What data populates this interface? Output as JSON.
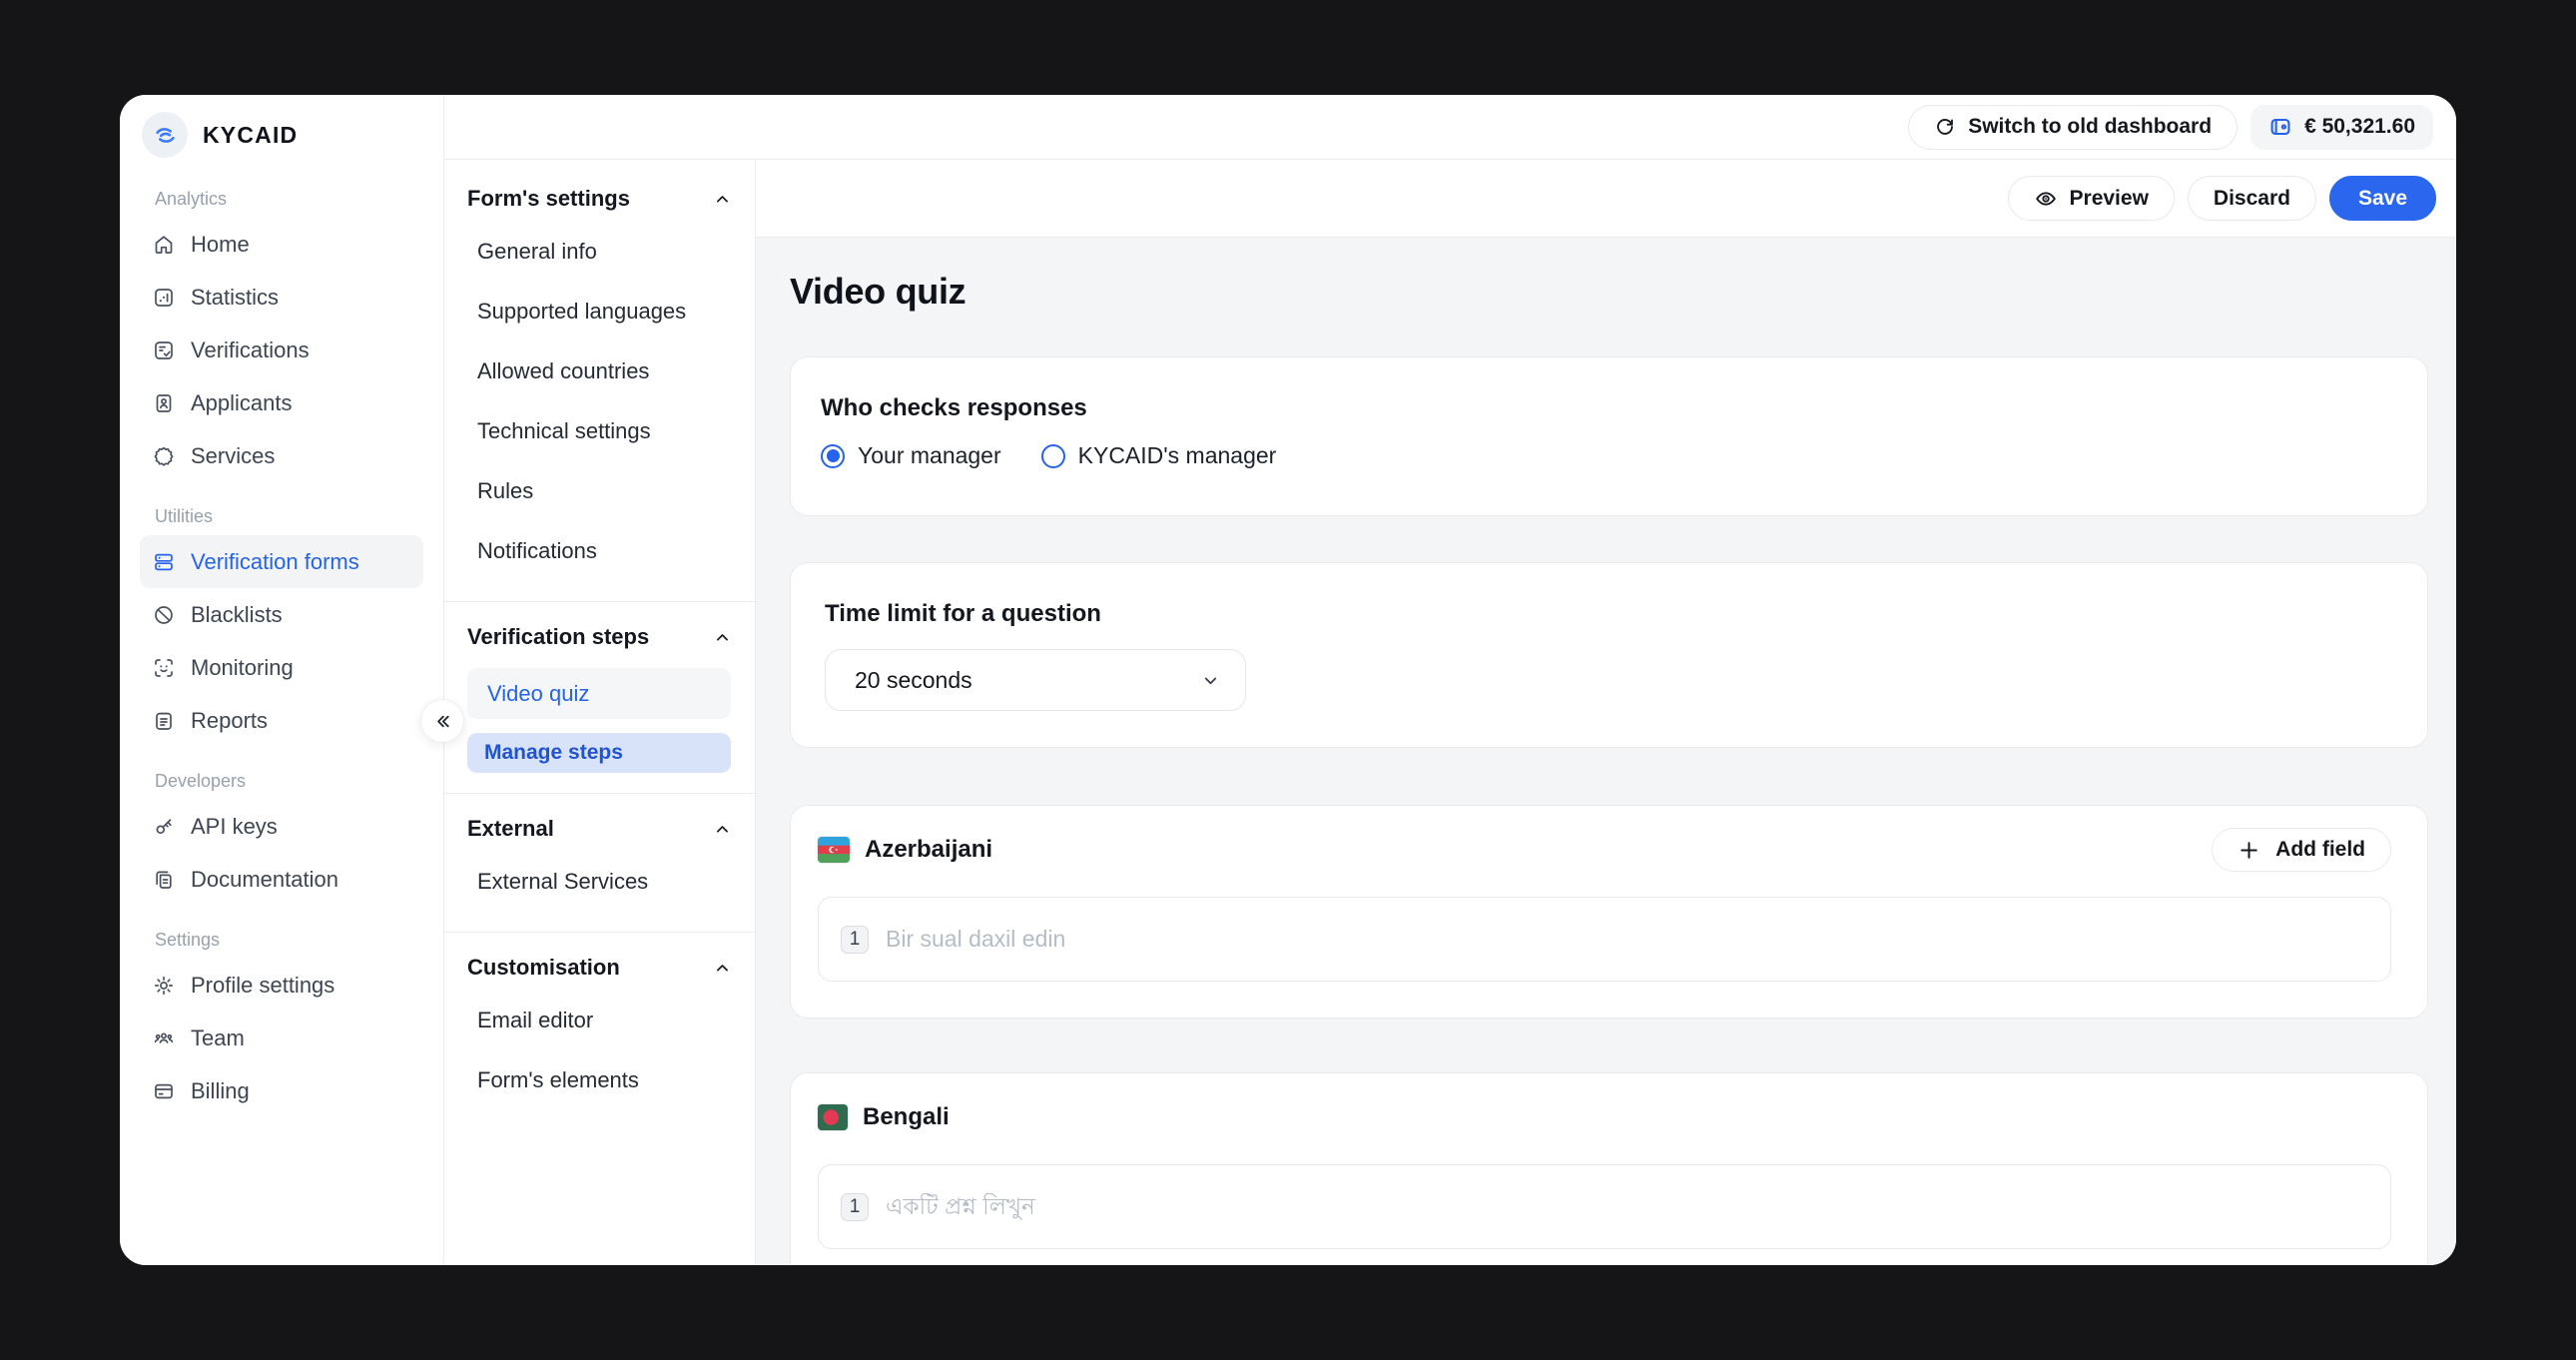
{
  "brand": {
    "name": "KYCAID",
    "logo_icon": "kycaid-swirl-icon",
    "accent_color": "#2563eb"
  },
  "header": {
    "switch_button": {
      "label": "Switch to old dashboard",
      "icon": "refresh-icon"
    },
    "balance": {
      "value": "€ 50,321.60",
      "icon": "wallet-icon"
    }
  },
  "toolbar": {
    "preview": {
      "label": "Preview",
      "icon": "eye-icon"
    },
    "discard": {
      "label": "Discard"
    },
    "save": {
      "label": "Save",
      "color": "#2a66ee"
    }
  },
  "sidebar": {
    "collapse_icon": "double-chevron-left-icon",
    "sections": [
      {
        "label": "Analytics",
        "items": [
          {
            "label": "Home",
            "icon": "home-icon"
          },
          {
            "label": "Statistics",
            "icon": "statistics-icon"
          },
          {
            "label": "Verifications",
            "icon": "verifications-icon"
          },
          {
            "label": "Applicants",
            "icon": "applicants-icon"
          },
          {
            "label": "Services",
            "icon": "services-icon"
          }
        ]
      },
      {
        "label": "Utilities",
        "items": [
          {
            "label": "Verification forms",
            "icon": "verification-forms-icon",
            "active": true
          },
          {
            "label": "Blacklists",
            "icon": "blacklists-icon"
          },
          {
            "label": "Monitoring",
            "icon": "monitoring-icon"
          },
          {
            "label": "Reports",
            "icon": "reports-icon"
          }
        ]
      },
      {
        "label": "Developers",
        "items": [
          {
            "label": "API keys",
            "icon": "api-keys-icon"
          },
          {
            "label": "Documentation",
            "icon": "documentation-icon"
          }
        ]
      },
      {
        "label": "Settings",
        "items": [
          {
            "label": "Profile settings",
            "icon": "profile-settings-icon"
          },
          {
            "label": "Team",
            "icon": "team-icon"
          },
          {
            "label": "Billing",
            "icon": "billing-icon"
          }
        ]
      }
    ]
  },
  "settings_nav": {
    "groups": [
      {
        "title": "Form's settings",
        "collapse_icon": "chevron-up-icon",
        "items": [
          "General info",
          "Supported languages",
          "Allowed countries",
          "Technical settings",
          "Rules",
          "Notifications"
        ]
      },
      {
        "title": "Verification steps",
        "collapse_icon": "chevron-up-icon",
        "items": [
          "Video quiz"
        ],
        "active_item": "Video quiz",
        "action_button": "Manage steps"
      },
      {
        "title": "External",
        "collapse_icon": "chevron-up-icon",
        "items": [
          "External Services"
        ]
      },
      {
        "title": "Customisation",
        "collapse_icon": "chevron-up-icon",
        "items": [
          "Email editor",
          "Form's elements"
        ]
      }
    ]
  },
  "main": {
    "page_title": "Video quiz",
    "who_checks": {
      "heading": "Who checks responses",
      "options": [
        {
          "label": "Your manager",
          "selected": true
        },
        {
          "label": "KYCAID's manager",
          "selected": false
        }
      ]
    },
    "time_limit": {
      "heading": "Time limit for a question",
      "selected_value": "20 seconds",
      "icon": "chevron-down-icon"
    },
    "language_cards": [
      {
        "name": "Azerbaijani",
        "flag_icon": "azerbaijan-flag",
        "question_index": "1",
        "placeholder": "Bir sual daxil edin",
        "add_button": {
          "label": "Add field",
          "icon": "plus-icon"
        }
      },
      {
        "name": "Bengali",
        "flag_icon": "bangladesh-flag",
        "question_index": "1",
        "placeholder": "একটি প্রশ্ন লিখুন"
      }
    ]
  },
  "colors": {
    "accent": "#2563eb",
    "background_dark": "#151517",
    "content_background": "#f4f5f6",
    "card_border": "#e9eaec",
    "muted_text": "#99a0ab",
    "manage_steps_bg": "#d8e2f8"
  }
}
